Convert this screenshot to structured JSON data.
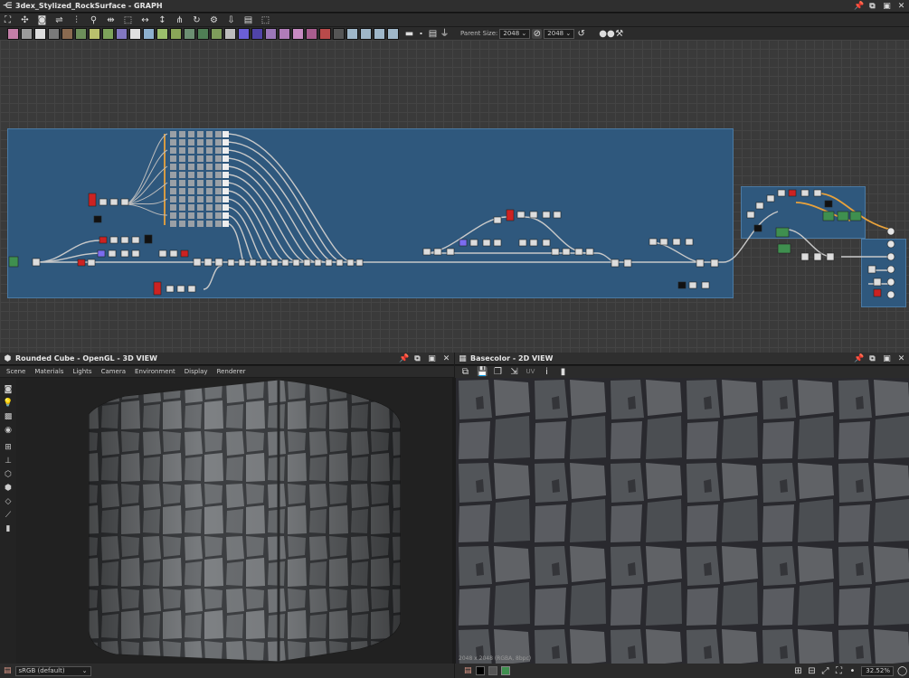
{
  "graph_panel": {
    "title": "3dex_Stylized_RockSurface - GRAPH",
    "parent_size_label": "Parent Size:",
    "parent_size_value": "2048",
    "output_size_value": "2048"
  },
  "view3d_panel": {
    "title": "Rounded Cube - OpenGL - 3D VIEW",
    "menu": [
      "Scene",
      "Materials",
      "Lights",
      "Camera",
      "Environment",
      "Display",
      "Renderer"
    ],
    "colorspace": "sRGB (default)"
  },
  "view2d_panel": {
    "title": "Basecolor - 2D VIEW",
    "image_info": "2048 x 2048 (RGBA, 8bpc)",
    "zoom": "32.52%"
  },
  "colors": {
    "frame_blue": "#2f587d",
    "graph_bg": "#3a3a3a",
    "rock": "#6e7275",
    "rock_dark": "#3a3b3f"
  },
  "icons": {
    "graph_toolbar_row1": [
      "frame-icon",
      "center-icon",
      "camera-icon",
      "link-icon",
      "align-icon",
      "align-h-icon",
      "align-v-icon",
      "split-icon",
      "settings-icon",
      "export-icon",
      "comment-icon",
      "frame-select-icon"
    ],
    "view3d_side": [
      "camera-icon",
      "light-icon",
      "environment-icon",
      "render-icon",
      "grid-icon",
      "axis-icon",
      "cube-icon",
      "cube-wire-icon",
      "plane-icon",
      "transform-icon",
      "histogram-icon"
    ]
  }
}
